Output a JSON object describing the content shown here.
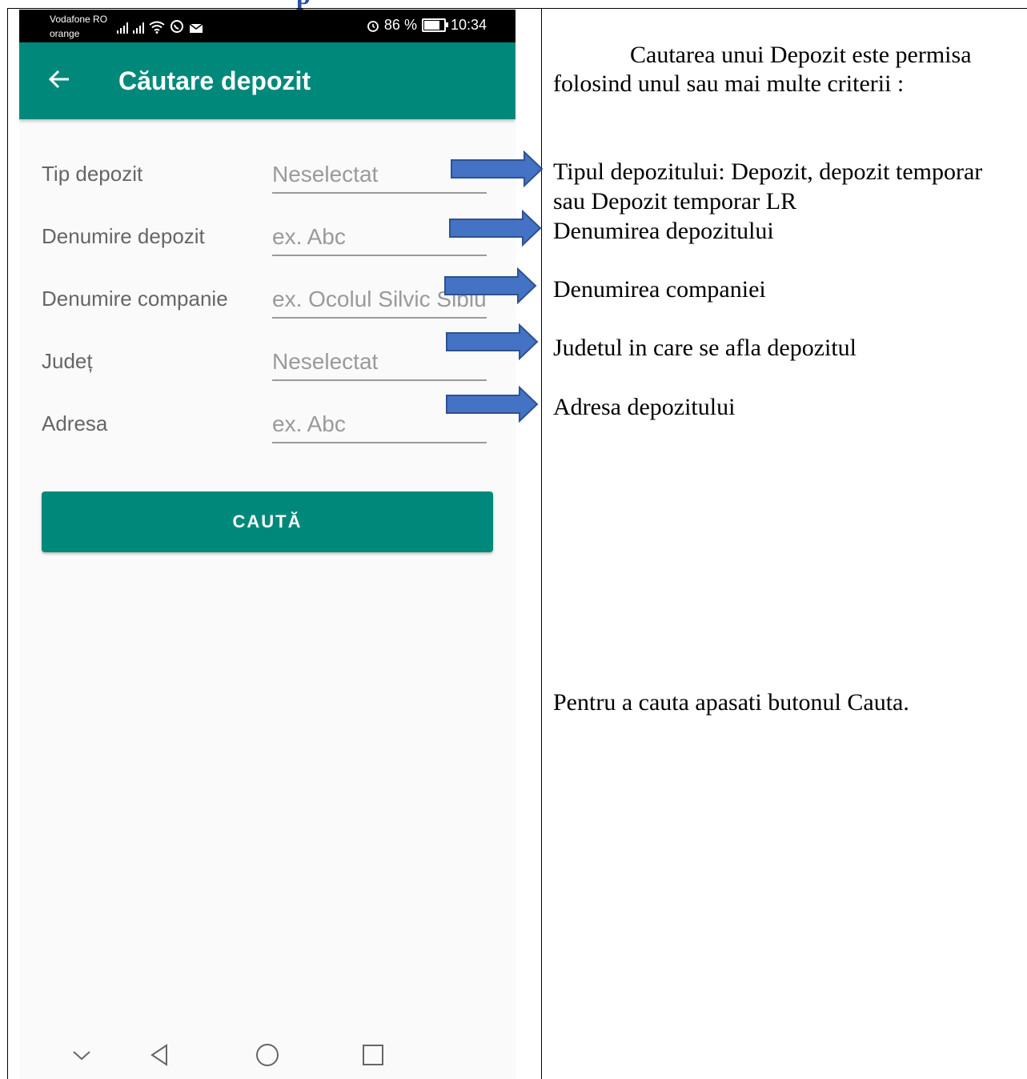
{
  "header_fragment": "p",
  "status_bar": {
    "carrier_1": "Vodafone RO",
    "carrier_2": "orange",
    "battery_percent_text": "86 %",
    "battery_level": 0.86,
    "time": "10:34",
    "icons": [
      "signal-icon",
      "signal-icon",
      "wifi-icon",
      "whatsapp-icon",
      "mail-icon",
      "alarm-icon",
      "battery-icon"
    ]
  },
  "app_bar": {
    "title": "Căutare depozit",
    "back_icon": "arrow-left-icon"
  },
  "form": {
    "fields": [
      {
        "label": "Tip depozit",
        "placeholder": "Neselectat"
      },
      {
        "label": "Denumire depozit",
        "placeholder": "ex. Abc"
      },
      {
        "label": "Denumire companie",
        "placeholder": "ex. Ocolul Silvic Sibiu"
      },
      {
        "label": "Județ",
        "placeholder": "Neselectat"
      },
      {
        "label": "Adresa",
        "placeholder": "ex. Abc"
      }
    ],
    "search_button": "CAUTĂ"
  },
  "nav_bar": {
    "icons": [
      "chevron-down-icon",
      "back-triangle-icon",
      "home-circle-icon",
      "recents-square-icon"
    ]
  },
  "notes": {
    "intro_line1": "Cautarea unui Depozit este permisa",
    "intro_line2": "folosind unul sau mai multe criterii :",
    "tip_line1": "Tipul depozitului: Depozit, depozit temporar",
    "tip_line2": "sau Depozit temporar LR",
    "denumire_depozit": "Denumirea depozitului",
    "denumire_companie": "Denumirea companiei",
    "judet": "Judetul in care se afla depozitul",
    "adresa": "Adresa depozitului",
    "cauta": "Pentru a cauta apasati butonul Cauta."
  },
  "colors": {
    "primary": "#00897b",
    "arrow_fill": "#4472c4",
    "arrow_stroke": "#2f528f",
    "header_text": "#2e4da8"
  }
}
